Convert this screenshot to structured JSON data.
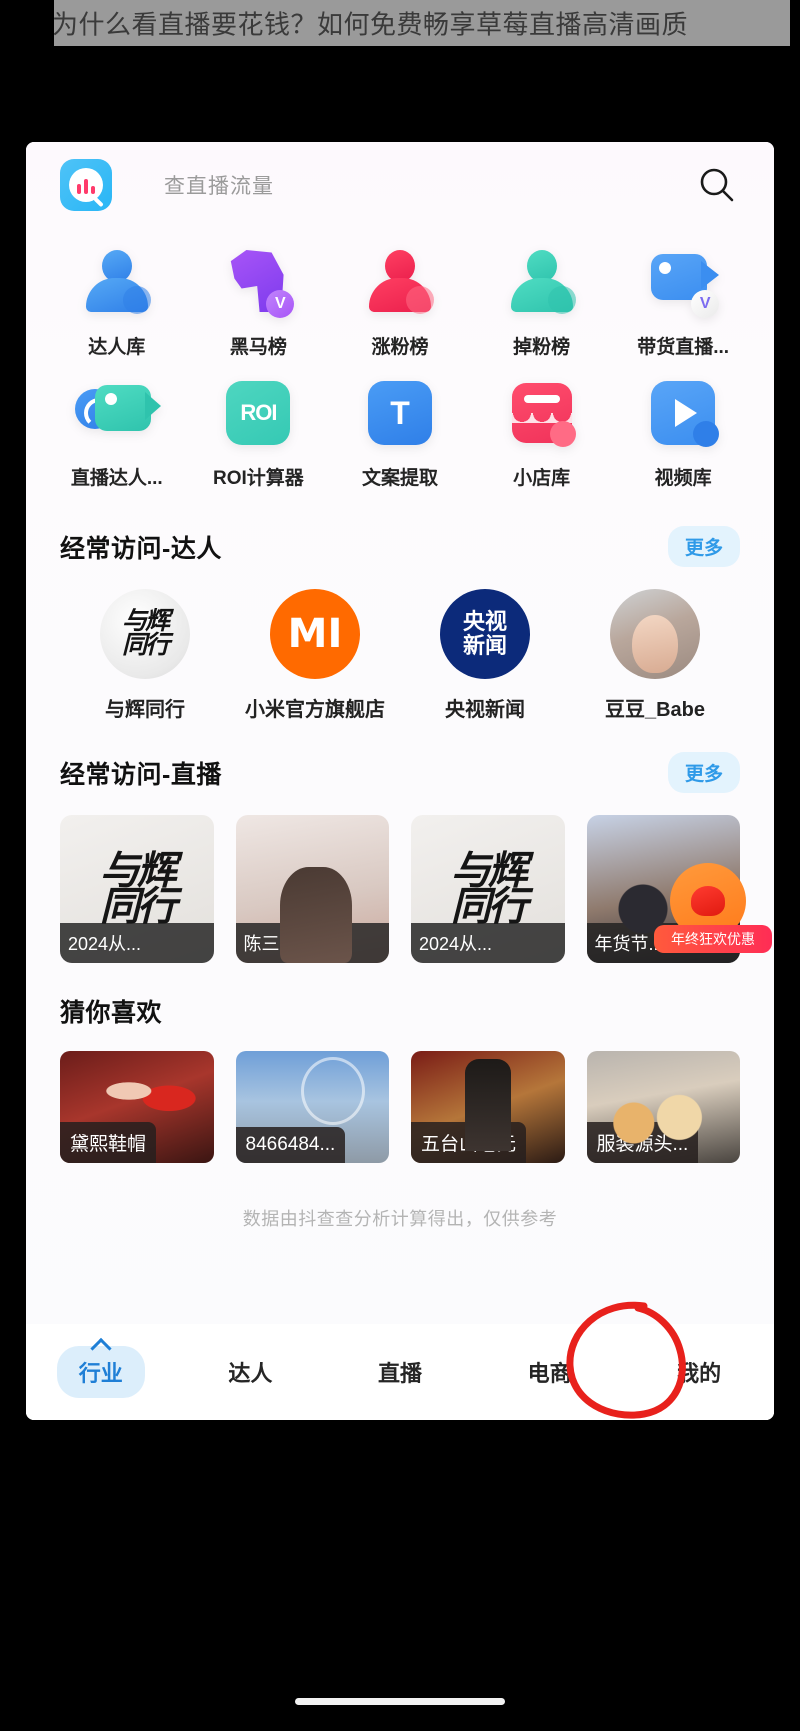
{
  "article": {
    "title": "为什么看直播要花钱？如何免费畅享草莓直播高清画质"
  },
  "app": {
    "logo_icon": "app-logo-icon",
    "search": {
      "placeholder": "查直播流量",
      "icon": "search-icon"
    }
  },
  "tools": {
    "row1": [
      {
        "label": "达人库",
        "icon": "person-blue-icon",
        "color": "#3b9cf0"
      },
      {
        "label": "黑马榜",
        "icon": "horse-purple-icon",
        "color": "#8b5cf6"
      },
      {
        "label": "涨粉榜",
        "icon": "person-red-icon",
        "color": "#f5325b"
      },
      {
        "label": "掉粉榜",
        "icon": "person-teal-icon",
        "color": "#3ed0b6"
      },
      {
        "label": "带货直播...",
        "icon": "camera-blue-icon",
        "color": "#4a9cf5"
      }
    ],
    "row2": [
      {
        "label": "直播达人...",
        "icon": "headset-camera-icon",
        "color": "#3ed0b6"
      },
      {
        "label": "ROI计算器",
        "icon": "roi-icon",
        "text": "ROI",
        "color": "#35c9b4"
      },
      {
        "label": "文案提取",
        "icon": "text-extract-icon",
        "text": "T",
        "color": "#2f7fe8"
      },
      {
        "label": "小店库",
        "icon": "shop-red-icon",
        "color": "#f0325a"
      },
      {
        "label": "视频库",
        "icon": "video-play-icon",
        "color": "#3b8ef0"
      }
    ]
  },
  "sections": {
    "talents": {
      "title": "经常访问-达人",
      "more_label": "更多",
      "items": [
        {
          "name": "与辉同行",
          "avatar": "calligraphy-avatar",
          "glyph": "与辉\n同行"
        },
        {
          "name": "小米官方旗舰店",
          "avatar": "xiaomi-logo-avatar",
          "glyph": "MI"
        },
        {
          "name": "央视新闻",
          "avatar": "cctv-news-avatar",
          "glyph_top": "央视",
          "glyph_bottom": "新闻"
        },
        {
          "name": "豆豆_Babe",
          "avatar": "photo-avatar"
        }
      ]
    },
    "lives": {
      "title": "经常访问-直播",
      "more_label": "更多",
      "items": [
        {
          "tag": "2024从...",
          "thumb": "calligraphy-thumb",
          "glyph": "与辉\n同行"
        },
        {
          "tag": "陈三废g...",
          "thumb": "room-thumb"
        },
        {
          "tag": "2024从...",
          "thumb": "calligraphy-thumb",
          "glyph": "与辉\n同行"
        },
        {
          "tag": "年货节...",
          "thumb": "stage-thumb"
        }
      ],
      "floating": {
        "label": "年终狂欢优惠",
        "icon": "gift-fab-icon"
      }
    },
    "recommend": {
      "title": "猜你喜欢",
      "items": [
        {
          "tag": "黛熙鞋帽",
          "thumb": "shoes-thumb"
        },
        {
          "tag": "8466484...",
          "thumb": "sky-ferris-thumb"
        },
        {
          "tag": "五台山老元",
          "thumb": "temple-thumb"
        },
        {
          "tag": "服装源头...",
          "thumb": "clothing-thumb"
        }
      ]
    }
  },
  "disclaimer": "数据由抖查查分析计算得出，仅供参考",
  "tabbar": {
    "items": [
      {
        "label": "行业",
        "active": true
      },
      {
        "label": "达人",
        "active": false
      },
      {
        "label": "直播",
        "active": false
      },
      {
        "label": "电商",
        "active": false
      },
      {
        "label": "我的",
        "active": false
      }
    ],
    "annotation": {
      "shape": "red-circle",
      "target": "我的",
      "color": "#e8211c"
    }
  }
}
